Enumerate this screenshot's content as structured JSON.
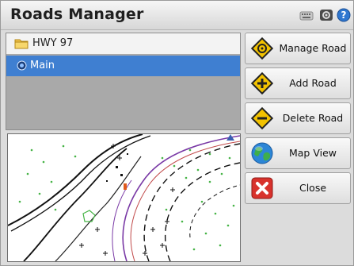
{
  "window": {
    "title": "Roads Manager"
  },
  "titlebar_icons": [
    "keyboard-icon",
    "settings-icon",
    "help-icon"
  ],
  "tree": {
    "items": [
      {
        "label": "HWY 97",
        "icon": "folder-icon",
        "selected": false
      },
      {
        "label": "Main",
        "icon": "road-icon",
        "selected": true
      }
    ]
  },
  "buttons": {
    "manage_road": "Manage Road",
    "add_road": "Add Road",
    "delete_road": "Delete Road",
    "map_view": "Map View",
    "close": "Close"
  },
  "colors": {
    "selection": "#3f7fd1",
    "sign_yellow": "#f2c200",
    "close_red": "#d8322c",
    "alignment_purple": "#7a3aa6",
    "points_green": "#46b446"
  }
}
